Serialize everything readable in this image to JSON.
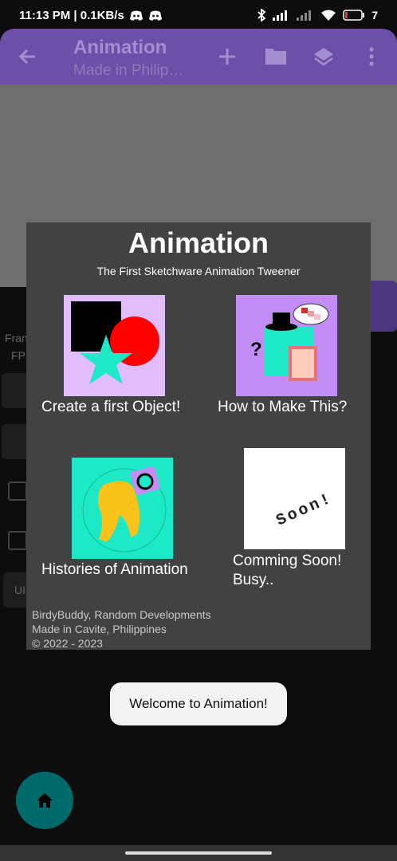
{
  "status": {
    "time_speed": "11:13 PM | 0.1KB/s",
    "battery": "7"
  },
  "appbar": {
    "title": "Animation",
    "subtitle": "Made in Philip…"
  },
  "background": {
    "frame_label": "Fran",
    "fps_label": "FP",
    "button_label": "UI"
  },
  "dialog": {
    "title": "Animation",
    "subtitle": "The First Sketchware Animation Tweener",
    "tiles": [
      {
        "label": "Create a first Object!"
      },
      {
        "label": "How to Make This?"
      },
      {
        "label": "Histories of Animation"
      },
      {
        "label_line1": "Comming Soon!",
        "label_line2": "Busy..",
        "image_text": "Soon!"
      }
    ],
    "footer": {
      "line1": "BirdyBuddy, Random Developments",
      "line2": "Made in Cavite, Philippines",
      "line3": "© 2022 - 2023"
    }
  },
  "toast": {
    "message": "Welcome to Animation!"
  },
  "colors": {
    "appbar": "#6c4fa8",
    "dialog": "#424242",
    "fab": "#006a6a",
    "accent_cyan": "#1de9b6"
  }
}
